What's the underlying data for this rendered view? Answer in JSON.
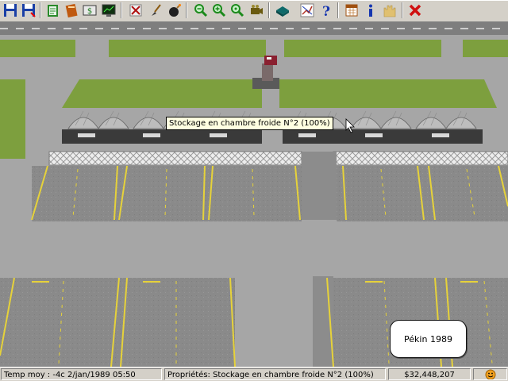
{
  "toolbar": {
    "buttons": [
      {
        "name": "save-icon",
        "color": "#1a3fa6"
      },
      {
        "name": "save-as-icon",
        "color": "#1a3fa6"
      },
      {
        "name": "reports-icon",
        "color": "#2a8a2a"
      },
      {
        "name": "documents-icon",
        "color": "#c05a10"
      },
      {
        "name": "finances-icon",
        "color": "#3a3a3a"
      },
      {
        "name": "graph-icon",
        "color": "#1e7a1e"
      },
      {
        "name": "bulldoze-icon",
        "color": "#b01010"
      },
      {
        "name": "brush-icon",
        "color": "#8a5a10"
      },
      {
        "name": "bomb-icon",
        "color": "#202020"
      },
      {
        "name": "zoom-out-icon",
        "color": "#1c8a1c"
      },
      {
        "name": "zoom-in-icon",
        "color": "#1c8a1c"
      },
      {
        "name": "zoom-reset-icon",
        "color": "#1c8a1c"
      },
      {
        "name": "camera-icon",
        "color": "#6a5a10"
      },
      {
        "name": "book-icon",
        "color": "#0f6a6a"
      },
      {
        "name": "chart-icon",
        "color": "#b03020"
      },
      {
        "name": "help-icon",
        "color": "#1636b0"
      },
      {
        "name": "calendar-icon",
        "color": "#a05010"
      },
      {
        "name": "info-icon",
        "color": "#1636b0"
      },
      {
        "name": "castle-icon",
        "color": "#e0c070"
      },
      {
        "name": "close-icon",
        "color": "#d01010"
      }
    ]
  },
  "tooltip": {
    "text": "Stockage en chambre froide N°2 (100%)"
  },
  "bubble": {
    "text": "Pékin 1989"
  },
  "status": {
    "left": "Temp moy : -4c   2/jan/1989 05:50",
    "middle": "Propriétés: Stockage en chambre froide N°2 (100%)",
    "money": "$32,448,207",
    "mood_icon": "smiley-icon"
  },
  "colors": {
    "grass": "#7d9f3e",
    "tarmac": "#a6a6a6",
    "runway": "#8c8c8c",
    "marking": "#e6d23a",
    "tooltip_bg": "#ffffe1",
    "toolbar_bg": "#d4d0c8"
  }
}
